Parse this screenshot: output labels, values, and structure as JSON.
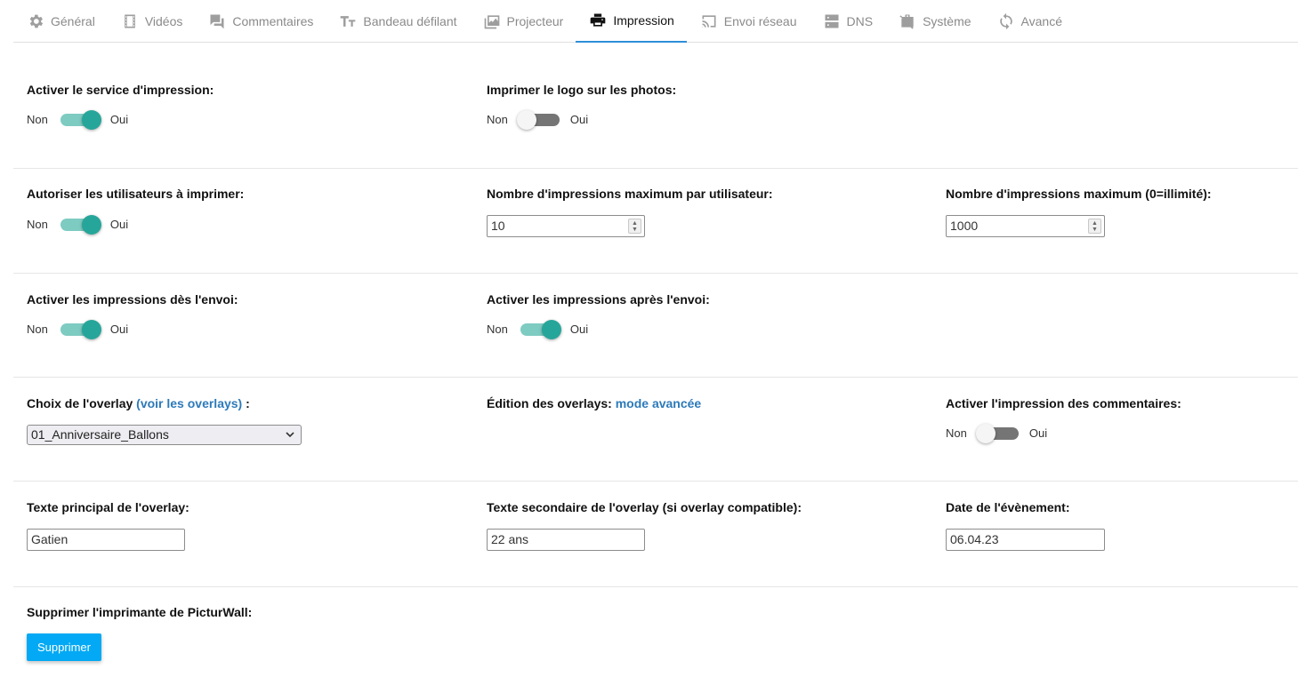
{
  "tabs": [
    {
      "label": "Général",
      "icon": "gear-icon"
    },
    {
      "label": "Vidéos",
      "icon": "film-icon"
    },
    {
      "label": "Commentaires",
      "icon": "comments-icon"
    },
    {
      "label": "Bandeau défilant",
      "icon": "text-size-icon"
    },
    {
      "label": "Projecteur",
      "icon": "images-icon"
    },
    {
      "label": "Impression",
      "icon": "printer-icon",
      "active": true
    },
    {
      "label": "Envoi réseau",
      "icon": "cast-icon"
    },
    {
      "label": "DNS",
      "icon": "server-icon"
    },
    {
      "label": "Système",
      "icon": "briefcase-off-icon"
    },
    {
      "label": "Avancé",
      "icon": "refresh-icon"
    }
  ],
  "toggle_labels": {
    "off": "Non",
    "on": "Oui"
  },
  "print_service": {
    "label": "Activer le service d'impression:",
    "on": true
  },
  "print_logo": {
    "label": "Imprimer le logo sur les photos:",
    "on": false
  },
  "allow_users": {
    "label": "Autoriser les utilisateurs à imprimer:",
    "on": true
  },
  "max_per_user": {
    "label": "Nombre d'impressions maximum par utilisateur:",
    "value": "10"
  },
  "max_total": {
    "label": "Nombre d'impressions maximum (0=illimité):",
    "value": "1000"
  },
  "print_on_send": {
    "label": "Activer les impressions dès l'envoi:",
    "on": true
  },
  "print_after_send": {
    "label": "Activer les impressions après l'envoi:",
    "on": true
  },
  "overlay_choice": {
    "label_prefix": "Choix de l'overlay ",
    "link": "(voir les overlays)",
    "label_suffix": " :",
    "selected": "01_Anniversaire_Ballons"
  },
  "overlay_edit": {
    "label": "Édition des overlays: ",
    "link": "mode avancée"
  },
  "print_comments": {
    "label": "Activer l'impression des commentaires:",
    "on": false
  },
  "overlay_main_text": {
    "label": "Texte principal de l'overlay:",
    "value": "Gatien"
  },
  "overlay_secondary_text": {
    "label": "Texte secondaire de l'overlay (si overlay compatible):",
    "value": "22 ans"
  },
  "event_date": {
    "label": "Date de l'évènement:",
    "value": "06.04.23"
  },
  "delete_printer": {
    "label": "Supprimer l'imprimante de PicturWall:",
    "button": "Supprimer"
  },
  "colors": {
    "accent": "#26a69a",
    "accent_track": "#7ecbc2",
    "link": "#2d7ab9",
    "button": "#03a9f4",
    "tab_underline": "#2d8fd8"
  }
}
